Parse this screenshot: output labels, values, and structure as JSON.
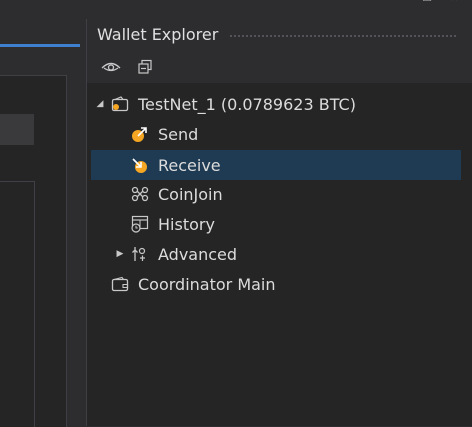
{
  "window_controls": {
    "minimize": "–",
    "maximize": "☐",
    "close": "✕"
  },
  "panel": {
    "title": "Wallet Explorer"
  },
  "toolbar": {
    "buttons": [
      {
        "name": "eye-icon",
        "tooltip": ""
      },
      {
        "name": "collapse-all-icon",
        "tooltip": ""
      }
    ]
  },
  "tree": {
    "wallet": {
      "label": "TestNet_1 (0.0789623 BTC)",
      "expanded": true,
      "icon": "wallet-icon"
    },
    "items": [
      {
        "label": "Send",
        "icon": "send-icon"
      },
      {
        "label": "Receive",
        "icon": "receive-icon",
        "selected": true
      },
      {
        "label": "CoinJoin",
        "icon": "coinjoin-icon"
      },
      {
        "label": "History",
        "icon": "history-icon"
      },
      {
        "label": "Advanced",
        "icon": "advanced-icon",
        "expandable": true,
        "expanded": false
      }
    ],
    "second_wallet": {
      "label": "Coordinator Main",
      "icon": "wallet-icon"
    }
  },
  "colors": {
    "accent": "#3e7fcf",
    "selection": "#1f3b53",
    "orange": "#f5a623"
  }
}
